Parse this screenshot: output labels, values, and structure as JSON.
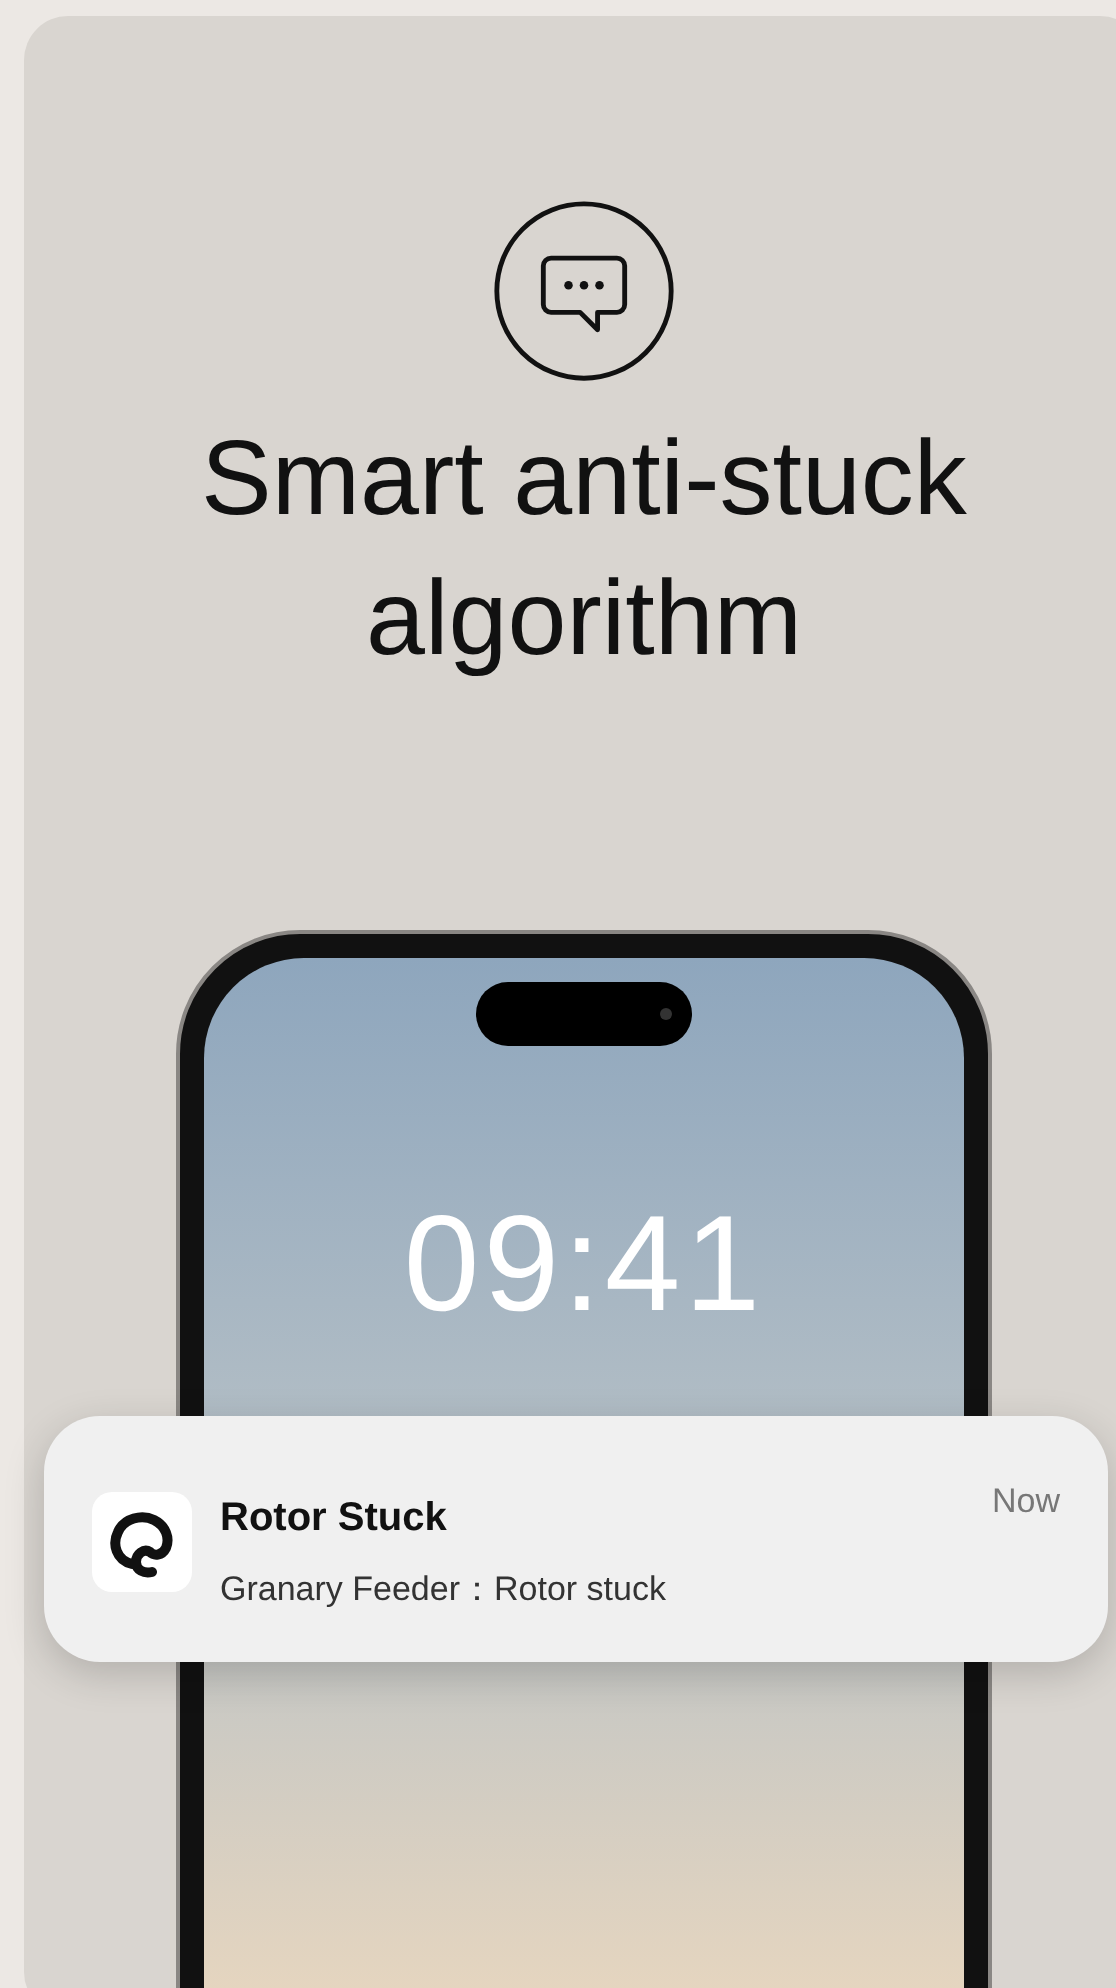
{
  "headline": {
    "title": "Smart anti-stuck algorithm"
  },
  "phone": {
    "lock_time": "09:41"
  },
  "notification": {
    "title": "Rotor Stuck",
    "message": "Granary Feeder：Rotor stuck",
    "time": "Now"
  }
}
